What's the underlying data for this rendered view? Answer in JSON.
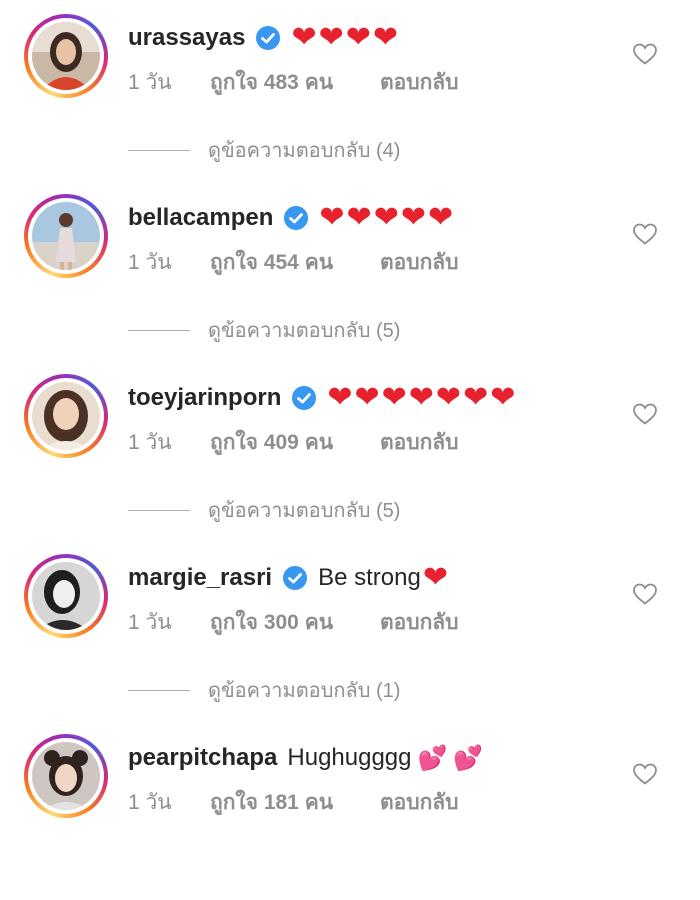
{
  "comments": [
    {
      "username": "urassayas",
      "text": "",
      "emoji": [
        "❤",
        "❤",
        "❤",
        "❤"
      ],
      "time": "1 วัน",
      "likes": "ถูกใจ 483 คน",
      "reply_label": "ตอบกลับ",
      "view_replies": "ดูข้อความตอบกลับ (4)"
    },
    {
      "username": "bellacampen",
      "text": "",
      "emoji": [
        "❤",
        "❤",
        "❤",
        "❤",
        "❤"
      ],
      "time": "1 วัน",
      "likes": "ถูกใจ 454 คน",
      "reply_label": "ตอบกลับ",
      "view_replies": "ดูข้อความตอบกลับ (5)"
    },
    {
      "username": "toeyjarinporn",
      "text": "",
      "emoji": [
        "❤",
        "❤",
        "❤",
        "❤",
        "❤",
        "❤",
        "❤"
      ],
      "time": "1 วัน",
      "likes": "ถูกใจ 409 คน",
      "reply_label": "ตอบกลับ",
      "view_replies": "ดูข้อความตอบกลับ (5)"
    },
    {
      "username": "margie_rasri",
      "text": "Be strong",
      "emoji": [
        "❤"
      ],
      "time": "1 วัน",
      "likes": "ถูกใจ 300 คน",
      "reply_label": "ตอบกลับ",
      "view_replies": "ดูข้อความตอบกลับ (1)"
    },
    {
      "username": "pearpitchapa",
      "text": "Hughugggg",
      "emoji": [
        "💕",
        "💕"
      ],
      "time": "1 วัน",
      "likes": "ถูกใจ 181 คน",
      "reply_label": "ตอบกลับ",
      "view_replies": ""
    }
  ],
  "colors": {
    "heart": "#e8212e",
    "verified": "#3897f0",
    "meta_text": "#8e8e8e",
    "username": "#262626"
  },
  "icons": {
    "verified": "verified-badge-icon",
    "like": "heart-outline-icon"
  }
}
